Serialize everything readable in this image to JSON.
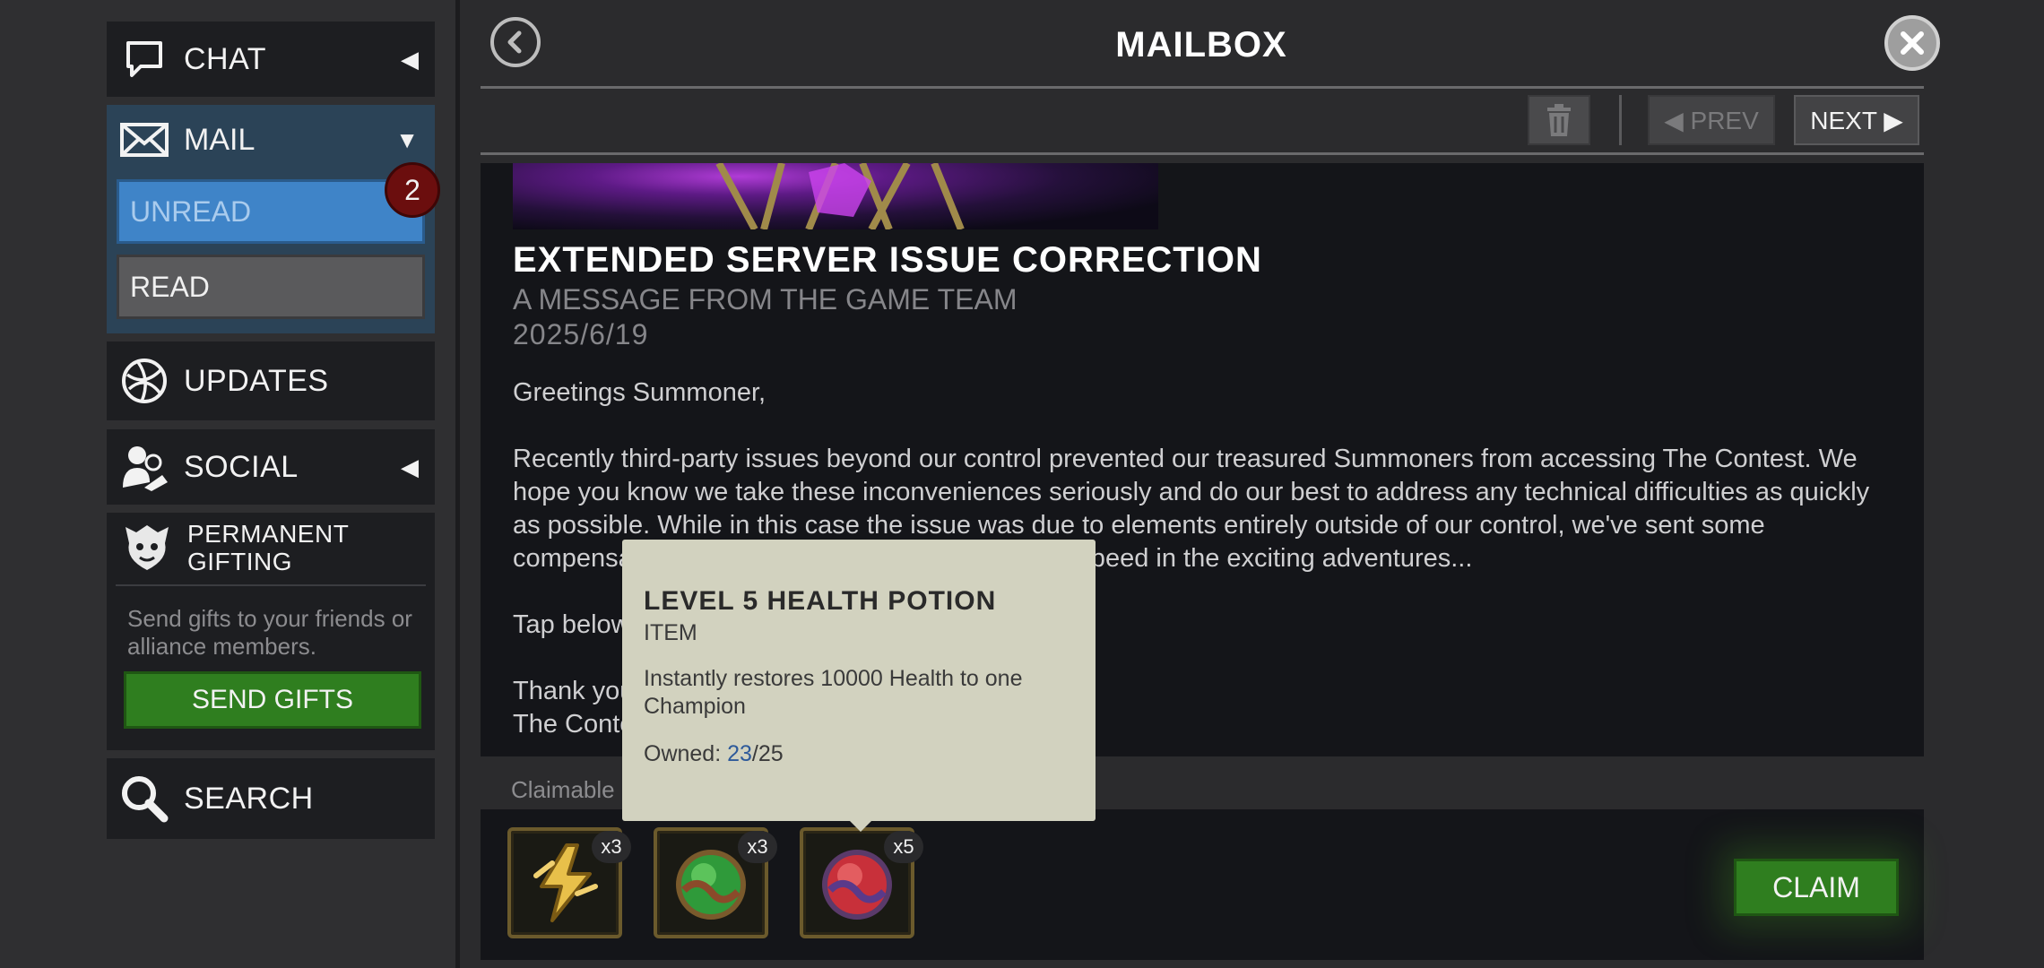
{
  "sidebar": {
    "chat": {
      "label": "CHAT",
      "arrow": "◀"
    },
    "mail": {
      "label": "MAIL",
      "arrow": "▼",
      "unread_label": "UNREAD",
      "read_label": "READ",
      "badge_count": "2"
    },
    "updates": {
      "label": "UPDATES"
    },
    "social": {
      "label": "SOCIAL",
      "arrow": "◀"
    },
    "gifting": {
      "title": "PERMANENT GIFTING",
      "description": "Send gifts to your friends or alliance members.",
      "button_label": "SEND GIFTS"
    },
    "search": {
      "label": "SEARCH"
    }
  },
  "header": {
    "title": "MAILBOX"
  },
  "toolbar": {
    "prev_label": "◀ PREV",
    "next_label": "NEXT ▶"
  },
  "message": {
    "title": "EXTENDED SERVER ISSUE CORRECTION",
    "subtitle": "A MESSAGE FROM THE GAME TEAM",
    "date": "2025/6/19",
    "greeting": "Greetings Summoner,",
    "para1": "Recently third-party issues beyond our control prevented our treasured Summoners from accessing The Contest. We hope you know we take these inconveniences seriously and do our best to address any technical difficulties as quickly as possible. While in this case the issue was due to elements entirely outside of our control, we've sent some compensation to get your Champions back up to speed in the exciting adventures...",
    "para2": "Tap below to claim...",
    "para3": "Thank you for your continued support.",
    "signature": "The Contest Team"
  },
  "rewards": {
    "section_label": "Claimable",
    "items": [
      {
        "icon": "energy-refill-icon",
        "qty": "x3"
      },
      {
        "icon": "revive-potion-icon",
        "qty": "x3"
      },
      {
        "icon": "health-potion-icon",
        "qty": "x5"
      }
    ],
    "claim_label": "CLAIM"
  },
  "tooltip": {
    "title": "LEVEL 5 HEALTH POTION",
    "type": "ITEM",
    "description": "Instantly restores 10000 Health to one Champion",
    "owned_label": "Owned: ",
    "owned_current": "23",
    "owned_max": "/25"
  },
  "colors": {
    "accent_green": "#2f7e1f",
    "unread_blue": "#3f84c8",
    "badge_red": "#6b0e0e",
    "tooltip_bg": "#d2d2bf"
  }
}
